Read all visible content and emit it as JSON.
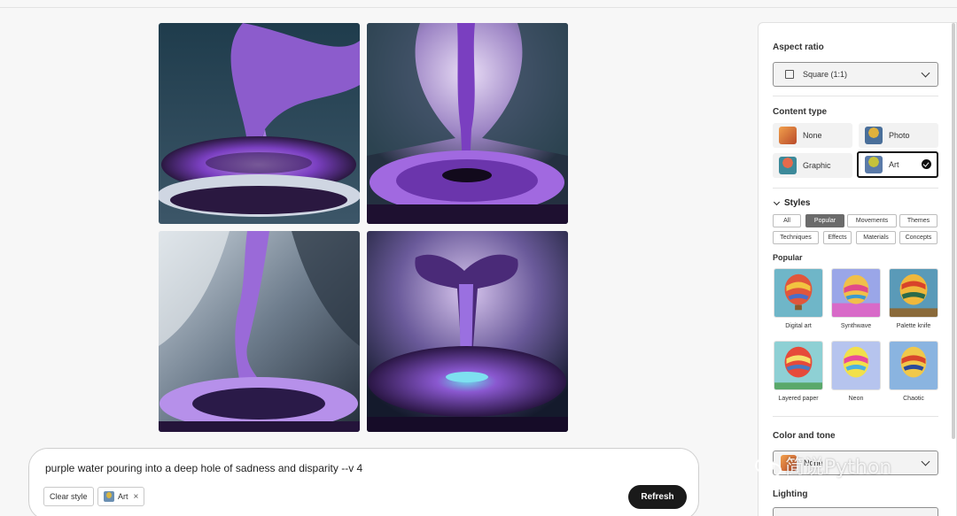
{
  "prompt": {
    "text": "purple water pouring into a deep hole of sadness and disparity --v 4",
    "clear_style_label": "Clear style",
    "art_chip_label": "Art",
    "remove_icon": "×",
    "refresh_label": "Refresh"
  },
  "results": {
    "images": [
      {
        "name": "result-image-1",
        "palette": [
          "#2f4a58",
          "#9b6bd6",
          "#2a1840"
        ]
      },
      {
        "name": "result-image-2",
        "palette": [
          "#6d7f90",
          "#7a3fc0",
          "#1e1030"
        ]
      },
      {
        "name": "result-image-3",
        "palette": [
          "#8a97a6",
          "#a378e0",
          "#24143a"
        ]
      },
      {
        "name": "result-image-4",
        "palette": [
          "#4a5a78",
          "#6e3ab0",
          "#160c28"
        ]
      }
    ]
  },
  "panel": {
    "aspect_ratio": {
      "title": "Aspect ratio",
      "value": "Square (1:1)"
    },
    "content_type": {
      "title": "Content type",
      "options": [
        {
          "label": "None",
          "selected": false
        },
        {
          "label": "Photo",
          "selected": false
        },
        {
          "label": "Graphic",
          "selected": false
        },
        {
          "label": "Art",
          "selected": true
        }
      ]
    },
    "styles": {
      "title": "Styles",
      "filters": [
        "All",
        "Popular",
        "Movements",
        "Themes",
        "Techniques",
        "Effects",
        "Materials",
        "Concepts"
      ],
      "active_filter": "Popular",
      "section_title": "Popular",
      "cards": [
        "Digital art",
        "Synthwave",
        "Palette knife",
        "Layered paper",
        "Neon",
        "Chaotic"
      ]
    },
    "color_and_tone": {
      "title": "Color and tone",
      "value": "None"
    },
    "lighting": {
      "title": "Lighting"
    }
  },
  "watermark": {
    "text": "简说Python"
  }
}
